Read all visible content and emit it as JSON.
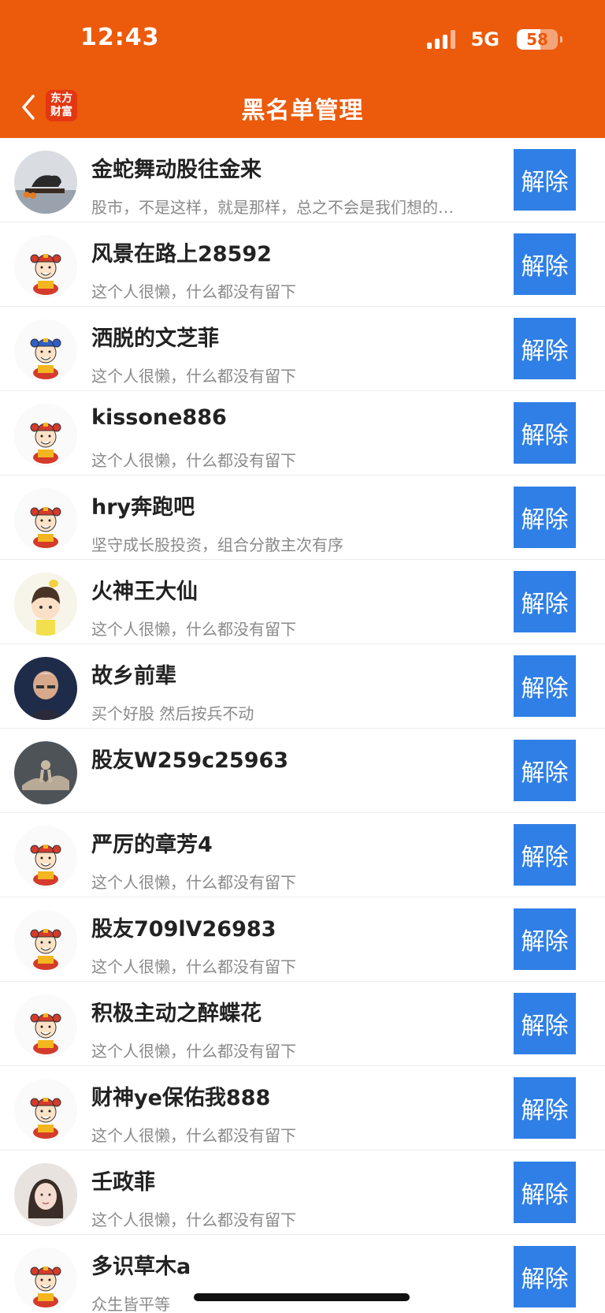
{
  "status_bar": {
    "time": "12:43",
    "network": "5G",
    "battery": "58"
  },
  "nav": {
    "logo_line1": "东方",
    "logo_line2": "财富",
    "title": "黑名单管理"
  },
  "unblock_label": "解除",
  "rows": [
    {
      "name": "金蛇舞动股往金来",
      "desc": "股市，不是这样，就是那样，总之不会是我们想的…",
      "avatar": "photo-bull"
    },
    {
      "name": "风景在路上28592",
      "desc": "这个人很懒，什么都没有留下",
      "avatar": "mascot-red"
    },
    {
      "name": "洒脱的文芝菲",
      "desc": "这个人很懒，什么都没有留下",
      "avatar": "mascot-blue"
    },
    {
      "name": "kissone886",
      "desc": "这个人很懒，什么都没有留下",
      "avatar": "mascot-red"
    },
    {
      "name": "hry奔跑吧",
      "desc": "坚守成长股投资，组合分散主次有序",
      "avatar": "mascot-red"
    },
    {
      "name": "火神王大仙",
      "desc": "这个人很懒，什么都没有留下",
      "avatar": "anime-boy"
    },
    {
      "name": "故乡前辈",
      "desc": "买个好股 然后按兵不动",
      "avatar": "photo-man"
    },
    {
      "name": "股友W259c25963",
      "desc": "",
      "avatar": "photo-sculpture"
    },
    {
      "name": "严厉的章芳4",
      "desc": "这个人很懒，什么都没有留下",
      "avatar": "mascot-red"
    },
    {
      "name": "股友709lV26983",
      "desc": "这个人很懒，什么都没有留下",
      "avatar": "mascot-red"
    },
    {
      "name": "积极主动之醉蝶花",
      "desc": "这个人很懒，什么都没有留下",
      "avatar": "mascot-red"
    },
    {
      "name": "财神ye保佑我888",
      "desc": "这个人很懒，什么都没有留下",
      "avatar": "mascot-red"
    },
    {
      "name": "壬政菲",
      "desc": "这个人很懒，什么都没有留下",
      "avatar": "photo-girl"
    },
    {
      "name": "多识草木a",
      "desc": "众生皆平等",
      "avatar": "mascot-red"
    }
  ]
}
